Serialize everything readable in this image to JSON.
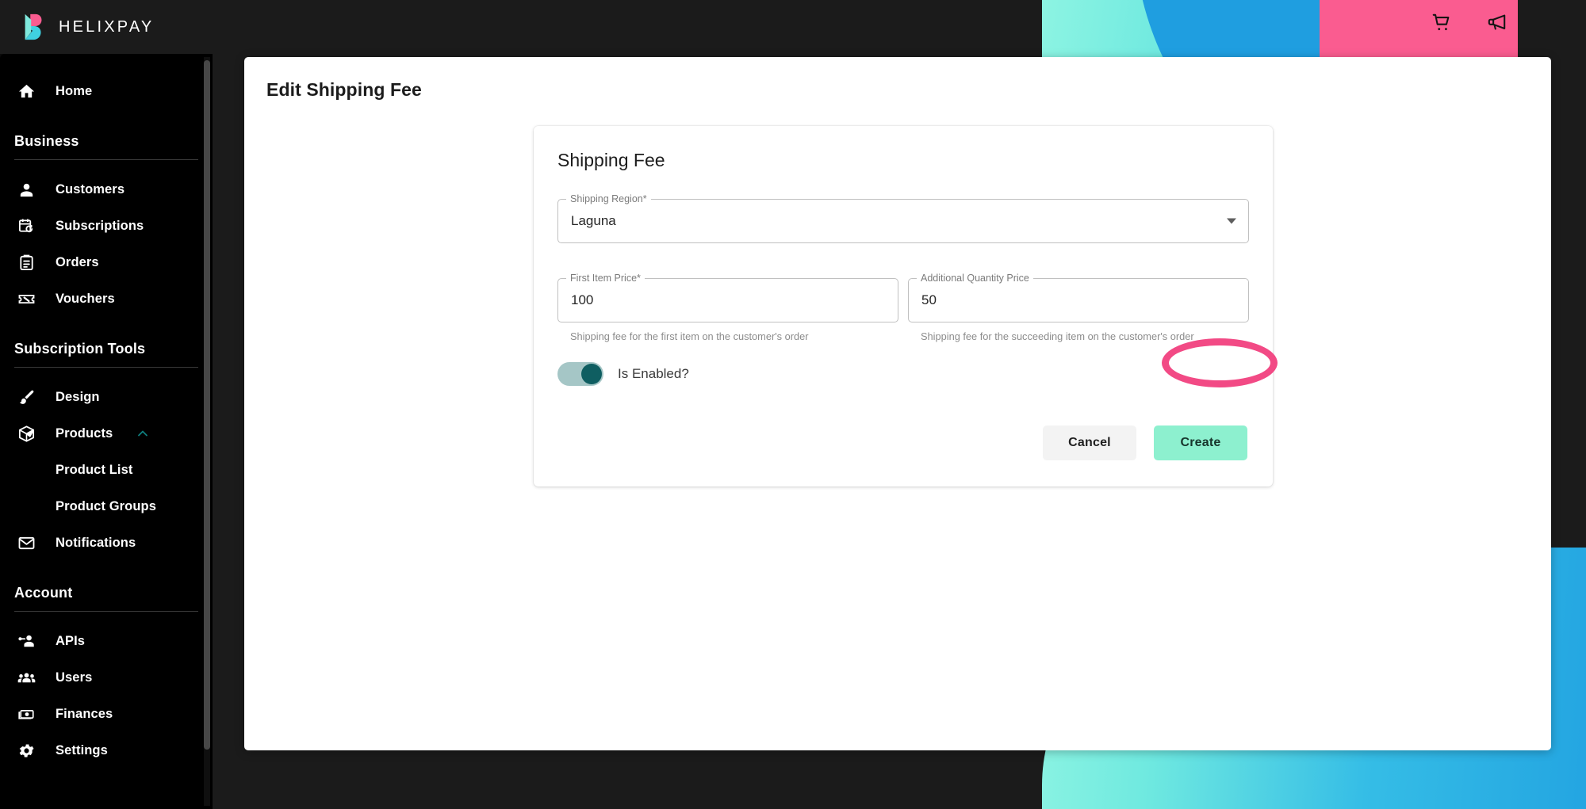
{
  "brand": {
    "name": "HELIXPAY",
    "logo_icon": "helixpay-logo-icon"
  },
  "topbar": {
    "cart_icon": "shopping-cart-icon",
    "announcement_icon": "megaphone-icon"
  },
  "sidebar": {
    "home": {
      "label": "Home",
      "icon": "home-icon"
    },
    "sections": [
      {
        "title": "Business",
        "items": [
          {
            "label": "Customers",
            "icon": "person-icon"
          },
          {
            "label": "Subscriptions",
            "icon": "calendar-sync-icon"
          },
          {
            "label": "Orders",
            "icon": "clipboard-icon"
          },
          {
            "label": "Vouchers",
            "icon": "voucher-percent-icon"
          }
        ]
      },
      {
        "title": "Subscription Tools",
        "items": [
          {
            "label": "Design",
            "icon": "paintbrush-icon"
          },
          {
            "label": "Products",
            "icon": "box-icon",
            "expanded": true,
            "chevron": "chevron-up-icon"
          },
          {
            "label": "Product List",
            "icon": "",
            "sub": true
          },
          {
            "label": "Product Groups",
            "icon": "",
            "sub": true
          },
          {
            "label": "Notifications",
            "icon": "envelope-icon"
          }
        ]
      },
      {
        "title": "Account",
        "items": [
          {
            "label": "APIs",
            "icon": "key-person-icon"
          },
          {
            "label": "Users",
            "icon": "people-group-icon"
          },
          {
            "label": "Finances",
            "icon": "money-icon"
          },
          {
            "label": "Settings",
            "icon": "gear-icon"
          }
        ]
      }
    ]
  },
  "page": {
    "title": "Edit Shipping Fee"
  },
  "form": {
    "card_title": "Shipping Fee",
    "shipping_region": {
      "label": "Shipping Region*",
      "value": "Laguna",
      "dropdown_icon": "chevron-down-icon"
    },
    "first_item_price": {
      "label": "First Item Price*",
      "value": "100",
      "helper": "Shipping fee for the first item on the customer's order"
    },
    "additional_quantity_price": {
      "label": "Additional Quantity Price",
      "value": "50",
      "helper": "Shipping fee for the succeeding item on the customer's order"
    },
    "is_enabled": {
      "label": "Is Enabled?",
      "state": "on"
    },
    "cancel_label": "Cancel",
    "create_label": "Create"
  },
  "colors": {
    "brand_pink": "#fa5c90",
    "brand_teal": "#8df4e2",
    "brand_blue": "#1f9ee0",
    "create_button": "#8df0cf",
    "highlight_ring": "#f24a85",
    "toggle_on_track": "#a5c6c6",
    "toggle_on_knob": "#0f5e61",
    "sidebar_bg": "#000000"
  }
}
